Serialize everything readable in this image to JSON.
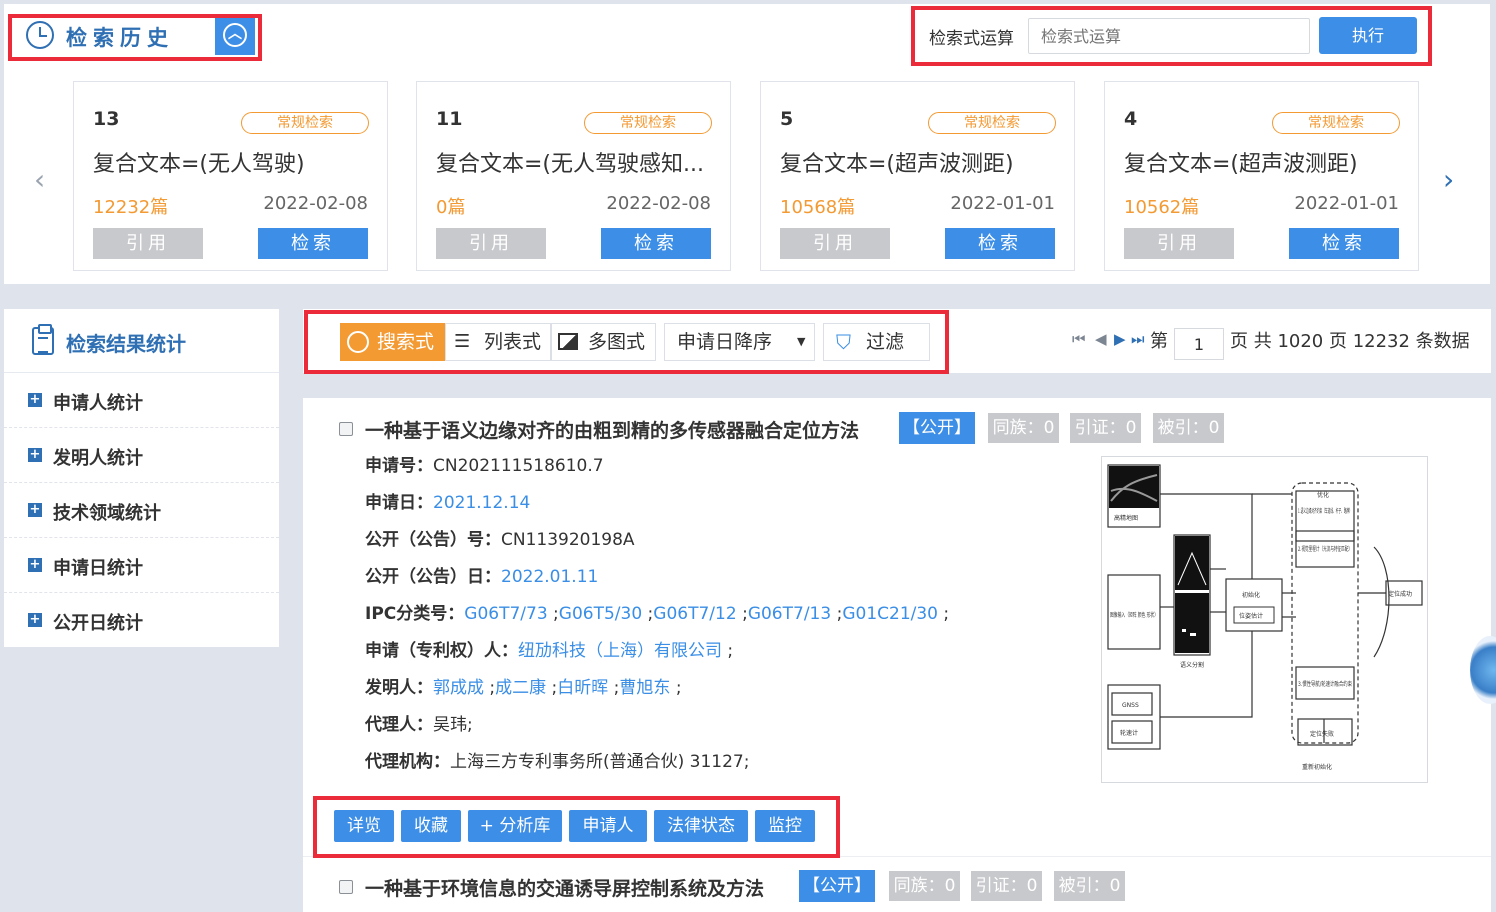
{
  "history": {
    "title": "检索历史",
    "collapse_icon": "chevron-up-circle-icon",
    "formula_label": "检索式运算",
    "formula_placeholder": "检索式运算",
    "exec_label": "执行",
    "cards": [
      {
        "num": "13",
        "tag": "常规检索",
        "expr": "复合文本=(无人驾驶)",
        "count": "12232篇",
        "date": "2022-02-08",
        "cite": "引用",
        "search": "检索"
      },
      {
        "num": "11",
        "tag": "常规检索",
        "expr": "复合文本=(无人驾驶感知...",
        "count": "0篇",
        "date": "2022-02-08",
        "cite": "引用",
        "search": "检索"
      },
      {
        "num": "5",
        "tag": "常规检索",
        "expr": "复合文本=(超声波测距)",
        "count": "10568篇",
        "date": "2022-01-01",
        "cite": "引用",
        "search": "检索"
      },
      {
        "num": "4",
        "tag": "常规检索",
        "expr": "复合文本=(超声波测距)",
        "count": "10562篇",
        "date": "2022-01-01",
        "cite": "引用",
        "search": "检索"
      }
    ]
  },
  "sidebar": {
    "title": "检索结果统计",
    "items": [
      "申请人统计",
      "发明人统计",
      "技术领域统计",
      "申请日统计",
      "公开日统计"
    ]
  },
  "toolbar": {
    "view_search": "搜索式",
    "view_list": "列表式",
    "view_multi": "多图式",
    "sort": "申请日降序",
    "filter": "过滤",
    "page_prefix": "第",
    "page_value": "1",
    "page_suffix": "页 共 1020 页 12232 条数据"
  },
  "results": [
    {
      "title": "一种基于语义边缘对齐的由粗到精的多传感器融合定位方法",
      "status": "【公开】",
      "family": "同族：0",
      "cite": "引证：0",
      "cited": "被引：0",
      "app_no_label": "申请号：",
      "app_no": "CN202111518610.7",
      "app_date_label": "申请日：",
      "app_date": "2021.12.14",
      "pub_no_label": "公开（公告）号：",
      "pub_no": "CN113920198A",
      "pub_date_label": "公开（公告）日：",
      "pub_date": "2022.01.11",
      "ipc_label": "IPC分类号：",
      "ipc": [
        "G06T7/73",
        "G06T5/30",
        "G06T7/12",
        "G06T7/13",
        "G01C21/30"
      ],
      "applicant_label": "申请（专利权）人：",
      "applicant": "纽劢科技（上海）有限公司",
      "inventor_label": "发明人：",
      "inventors": [
        "郭成成",
        "成二康",
        "白昕晖",
        "曹旭东"
      ],
      "agent_label": "代理人：",
      "agent": "吴玮;",
      "agency_label": "代理机构：",
      "agency": "上海三方专利事务所(普通合伙) 31127;",
      "actions": [
        "详览",
        "收藏",
        "+ 分析库",
        "申请人",
        "法律状态",
        "监控"
      ],
      "figure_labels": {
        "map": "高精地图",
        "image_input": "图像输入（矩阵 颜色 形状）",
        "semantic": "语义分割",
        "init": "初始化",
        "pose": "位姿估计",
        "optimize": "优化",
        "opt_1": "1.语义边缘对齐约束（车道线、杆子、路牌）",
        "opt_2": "2.视觉里程计（光流与特征匹配）",
        "opt_3": "3.惯性导航/轮速计融合约束",
        "success": "定位成功",
        "gnss": "GNSS",
        "imu": "轮速计",
        "fail": "定位失败",
        "reinit": "重新初始化"
      }
    },
    {
      "title": "一种基于环境信息的交通诱导屏控制系统及方法",
      "status": "【公开】",
      "family": "同族：0",
      "cite": "引证：0",
      "cited": "被引：0"
    }
  ],
  "colors": {
    "accent": "#3d8ee6",
    "orange": "#f39a33",
    "highlight_border": "#ec2b3a"
  }
}
